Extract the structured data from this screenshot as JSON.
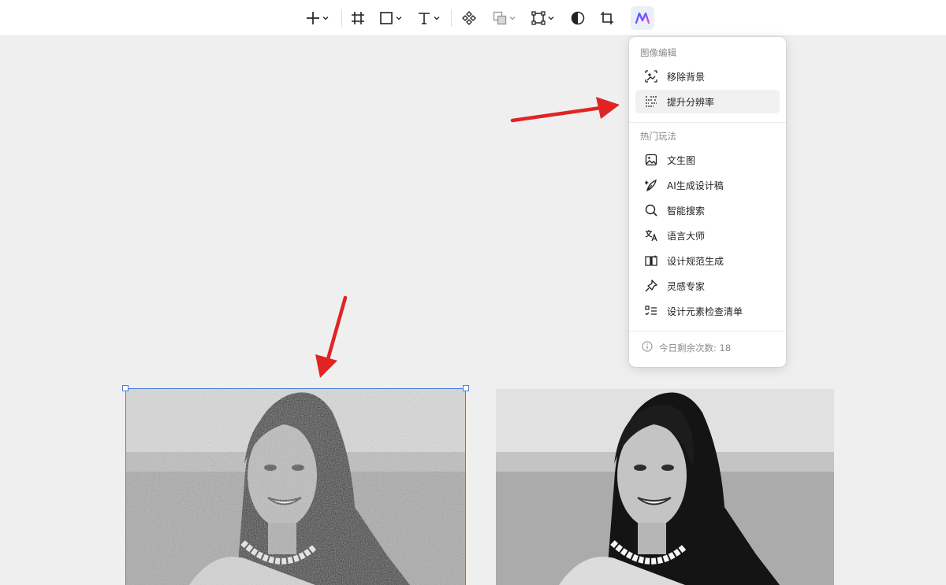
{
  "toolbar": {
    "tools": [
      {
        "icon": "plus-icon",
        "has_dropdown": true
      },
      {
        "icon": "frame-icon",
        "has_dropdown": false
      },
      {
        "icon": "rectangle-icon",
        "has_dropdown": true
      },
      {
        "icon": "text-icon",
        "has_dropdown": true
      },
      {
        "icon": "component-icon",
        "has_dropdown": false
      },
      {
        "icon": "boolean-icon",
        "has_dropdown": true,
        "disabled": true
      },
      {
        "icon": "path-icon",
        "has_dropdown": true
      },
      {
        "icon": "mask-icon",
        "has_dropdown": false
      },
      {
        "icon": "crop-icon",
        "has_dropdown": false
      },
      {
        "icon": "ai-icon",
        "has_dropdown": false,
        "active": true
      }
    ]
  },
  "ai_menu": {
    "section_image_edit": "图像编辑",
    "image_edit_items": [
      {
        "label": "移除背景",
        "icon": "remove-background-icon"
      },
      {
        "label": "提升分辨率",
        "icon": "upscale-icon",
        "highlighted": true
      }
    ],
    "section_popular": "热门玩法",
    "popular_items": [
      {
        "label": "文生图",
        "icon": "text-to-image-icon"
      },
      {
        "label": "AI生成设计稿",
        "icon": "ai-design-icon"
      },
      {
        "label": "智能搜索",
        "icon": "smart-search-icon"
      },
      {
        "label": "语言大师",
        "icon": "translate-icon"
      },
      {
        "label": "设计规范生成",
        "icon": "design-spec-icon"
      },
      {
        "label": "灵感专家",
        "icon": "inspiration-icon"
      },
      {
        "label": "设计元素检查清单",
        "icon": "checklist-icon"
      }
    ],
    "footer": "今日剩余次数: 18"
  },
  "colors": {
    "accent": "#4a7fe0",
    "annotation_arrow": "#e02424",
    "canvas_bg": "#efefef"
  }
}
